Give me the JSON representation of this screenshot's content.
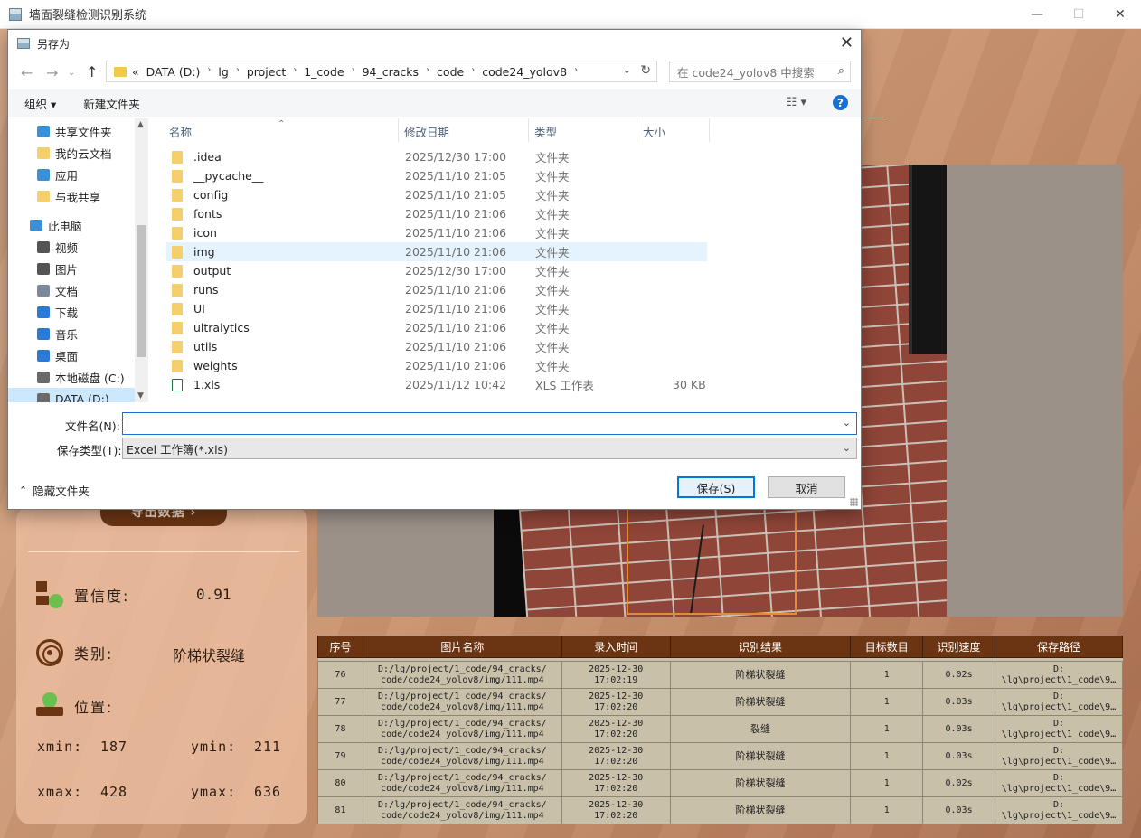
{
  "main_window": {
    "title": "墙面裂缝检测识别系统",
    "minimize": "—",
    "maximize": "☐",
    "close": "✕"
  },
  "left_panel": {
    "export_label": "导出数据 ›",
    "confidence_label": "置信度:",
    "confidence_value": "0.91",
    "category_label": "类别:",
    "category_value": "阶梯状裂缝",
    "position_label": "位置:",
    "xmin_label": "xmin:",
    "xmin": "187",
    "ymin_label": "ymin:",
    "ymin": "211",
    "xmax_label": "xmax:",
    "xmax": "428",
    "ymax_label": "ymax:",
    "ymax": "636"
  },
  "results_table": {
    "headers": [
      "序号",
      "图片名称",
      "录入时间",
      "识别结果",
      "目标数目",
      "识别速度",
      "保存路径"
    ],
    "rows": [
      {
        "id": "76",
        "name": "D:/lg/project/1_code/94_cracks/\ncode/code24_yolov8/img/111.mp4",
        "time": "2025-12-30\n17:02:19",
        "result": "阶梯状裂缝",
        "count": "1",
        "speed": "0.02s",
        "path": "D:\n\\lg\\project\\1_code\\9…"
      },
      {
        "id": "77",
        "name": "D:/lg/project/1_code/94_cracks/\ncode/code24_yolov8/img/111.mp4",
        "time": "2025-12-30\n17:02:20",
        "result": "阶梯状裂缝",
        "count": "1",
        "speed": "0.03s",
        "path": "D:\n\\lg\\project\\1_code\\9…"
      },
      {
        "id": "78",
        "name": "D:/lg/project/1_code/94_cracks/\ncode/code24_yolov8/img/111.mp4",
        "time": "2025-12-30\n17:02:20",
        "result": "裂缝",
        "count": "1",
        "speed": "0.03s",
        "path": "D:\n\\lg\\project\\1_code\\9…"
      },
      {
        "id": "79",
        "name": "D:/lg/project/1_code/94_cracks/\ncode/code24_yolov8/img/111.mp4",
        "time": "2025-12-30\n17:02:20",
        "result": "阶梯状裂缝",
        "count": "1",
        "speed": "0.03s",
        "path": "D:\n\\lg\\project\\1_code\\9…"
      },
      {
        "id": "80",
        "name": "D:/lg/project/1_code/94_cracks/\ncode/code24_yolov8/img/111.mp4",
        "time": "2025-12-30\n17:02:20",
        "result": "阶梯状裂缝",
        "count": "1",
        "speed": "0.02s",
        "path": "D:\n\\lg\\project\\1_code\\9…"
      },
      {
        "id": "81",
        "name": "D:/lg/project/1_code/94_cracks/\ncode/code24_yolov8/img/111.mp4",
        "time": "2025-12-30\n17:02:20",
        "result": "阶梯状裂缝",
        "count": "1",
        "speed": "0.03s",
        "path": "D:\n\\lg\\project\\1_code\\9…"
      }
    ]
  },
  "dialog": {
    "title": "另存为",
    "close": "✕",
    "address": {
      "prefix": "«",
      "segments": [
        "DATA (D:)",
        "lg",
        "project",
        "1_code",
        "94_cracks",
        "code",
        "code24_yolov8"
      ]
    },
    "search_placeholder": "在 code24_yolov8 中搜索",
    "toolbar": {
      "organize": "组织 ▾",
      "new_folder": "新建文件夹",
      "help": "?"
    },
    "nav_items": [
      {
        "label": "共享文件夹",
        "icon": "share-icon",
        "color": "#3a8fd6"
      },
      {
        "label": "我的云文档",
        "icon": "folder-icon",
        "color": "#f5cf6b"
      },
      {
        "label": "应用",
        "icon": "apps-icon",
        "color": "#3a8fd6"
      },
      {
        "label": "与我共享",
        "icon": "folder-icon",
        "color": "#f5cf6b"
      },
      {
        "label": "此电脑",
        "icon": "computer-icon",
        "color": "#3a8fd6"
      },
      {
        "label": "视频",
        "icon": "video-icon",
        "color": "#555555"
      },
      {
        "label": "图片",
        "icon": "picture-icon",
        "color": "#555555"
      },
      {
        "label": "文档",
        "icon": "document-icon",
        "color": "#7a8a9a"
      },
      {
        "label": "下载",
        "icon": "download-icon",
        "color": "#2b7bd6"
      },
      {
        "label": "音乐",
        "icon": "music-icon",
        "color": "#2b7bd6"
      },
      {
        "label": "桌面",
        "icon": "desktop-icon",
        "color": "#2b7bd6"
      },
      {
        "label": "本地磁盘 (C:)",
        "icon": "disk-icon",
        "color": "#6a6a6a"
      },
      {
        "label": "DATA (D:)",
        "icon": "disk-icon",
        "color": "#6a6a6a"
      }
    ],
    "columns": {
      "name": "名称",
      "date": "修改日期",
      "type": "类型",
      "size": "大小"
    },
    "files": [
      {
        "name": ".idea",
        "date": "2025/12/30 17:00",
        "type": "文件夹",
        "size": ""
      },
      {
        "name": "__pycache__",
        "date": "2025/11/10 21:05",
        "type": "文件夹",
        "size": ""
      },
      {
        "name": "config",
        "date": "2025/11/10 21:05",
        "type": "文件夹",
        "size": ""
      },
      {
        "name": "fonts",
        "date": "2025/11/10 21:06",
        "type": "文件夹",
        "size": ""
      },
      {
        "name": "icon",
        "date": "2025/11/10 21:06",
        "type": "文件夹",
        "size": ""
      },
      {
        "name": "img",
        "date": "2025/11/10 21:06",
        "type": "文件夹",
        "size": ""
      },
      {
        "name": "output",
        "date": "2025/12/30 17:00",
        "type": "文件夹",
        "size": ""
      },
      {
        "name": "runs",
        "date": "2025/11/10 21:06",
        "type": "文件夹",
        "size": ""
      },
      {
        "name": "UI",
        "date": "2025/11/10 21:06",
        "type": "文件夹",
        "size": ""
      },
      {
        "name": "ultralytics",
        "date": "2025/11/10 21:06",
        "type": "文件夹",
        "size": ""
      },
      {
        "name": "utils",
        "date": "2025/11/10 21:06",
        "type": "文件夹",
        "size": ""
      },
      {
        "name": "weights",
        "date": "2025/11/10 21:06",
        "type": "文件夹",
        "size": ""
      },
      {
        "name": "1.xls",
        "date": "2025/11/12 10:42",
        "type": "XLS 工作表",
        "size": "30 KB"
      }
    ],
    "filename_label": "文件名(N):",
    "filename_value": "",
    "filetype_label": "保存类型(T):",
    "filetype_value": "Excel 工作簿(*.xls)",
    "save_button": "保存(S)",
    "cancel_button": "取消",
    "hide_folders": "隐藏文件夹"
  }
}
